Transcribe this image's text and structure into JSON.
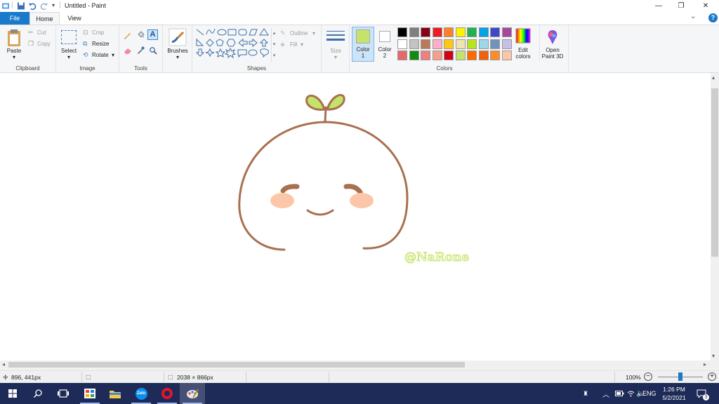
{
  "window": {
    "title": "Untitled - Paint",
    "minimize": "—",
    "restore": "❐",
    "close": "✕"
  },
  "tabs": {
    "file": "File",
    "home": "Home",
    "view": "View"
  },
  "ribbon": {
    "clipboard": {
      "label": "Clipboard",
      "paste": "Paste",
      "cut": "Cut",
      "copy": "Copy"
    },
    "image": {
      "label": "Image",
      "select": "Select",
      "crop": "Crop",
      "resize": "Resize",
      "rotate": "Rotate"
    },
    "tools": {
      "label": "Tools"
    },
    "brushes": {
      "label": "Brushes"
    },
    "shapes": {
      "label": "Shapes",
      "outline": "Outline",
      "fill": "Fill"
    },
    "size": {
      "label": "Size"
    },
    "colors": {
      "label": "Colors",
      "color1": "Color",
      "color1_num": "1",
      "color2": "Color",
      "color2_num": "2",
      "color1_value": "#c5e26a",
      "color2_value": "#ffffff",
      "edit_colors_1": "Edit",
      "edit_colors_2": "colors",
      "paint3d_1": "Open",
      "paint3d_2": "Paint 3D",
      "palette_row1": [
        "#000000",
        "#7f7f7f",
        "#880015",
        "#ed1c24",
        "#ff7f27",
        "#fff200",
        "#22b14c",
        "#00a2e8",
        "#3f48cc",
        "#a349a4"
      ],
      "palette_row2": [
        "#ffffff",
        "#c3c3c3",
        "#b97a57",
        "#ffaec9",
        "#ffc90e",
        "#efe4b0",
        "#b5e61d",
        "#99d9ea",
        "#7092be",
        "#c8bfe7"
      ],
      "palette_row3": [
        "#e36a6a",
        "#128a12",
        "#f08080",
        "#f4a08a",
        "#d4001a",
        "#c5e26a",
        "#ff6a00",
        "#f2600a",
        "#ff8a2a",
        "#fcc6a8"
      ]
    }
  },
  "canvas": {
    "watermark": "@NaRone",
    "stroke_color": "#a9704f",
    "leaf_color": "#c5e26a",
    "cheek_color": "#fbc7a8"
  },
  "status": {
    "cursor": "896, 441px",
    "dimensions": "2038 × 866px",
    "zoom": "100%"
  },
  "taskbar": {
    "lang": "ENG",
    "time": "1:26 PM",
    "date": "5/2/2021",
    "notifications": "3"
  }
}
